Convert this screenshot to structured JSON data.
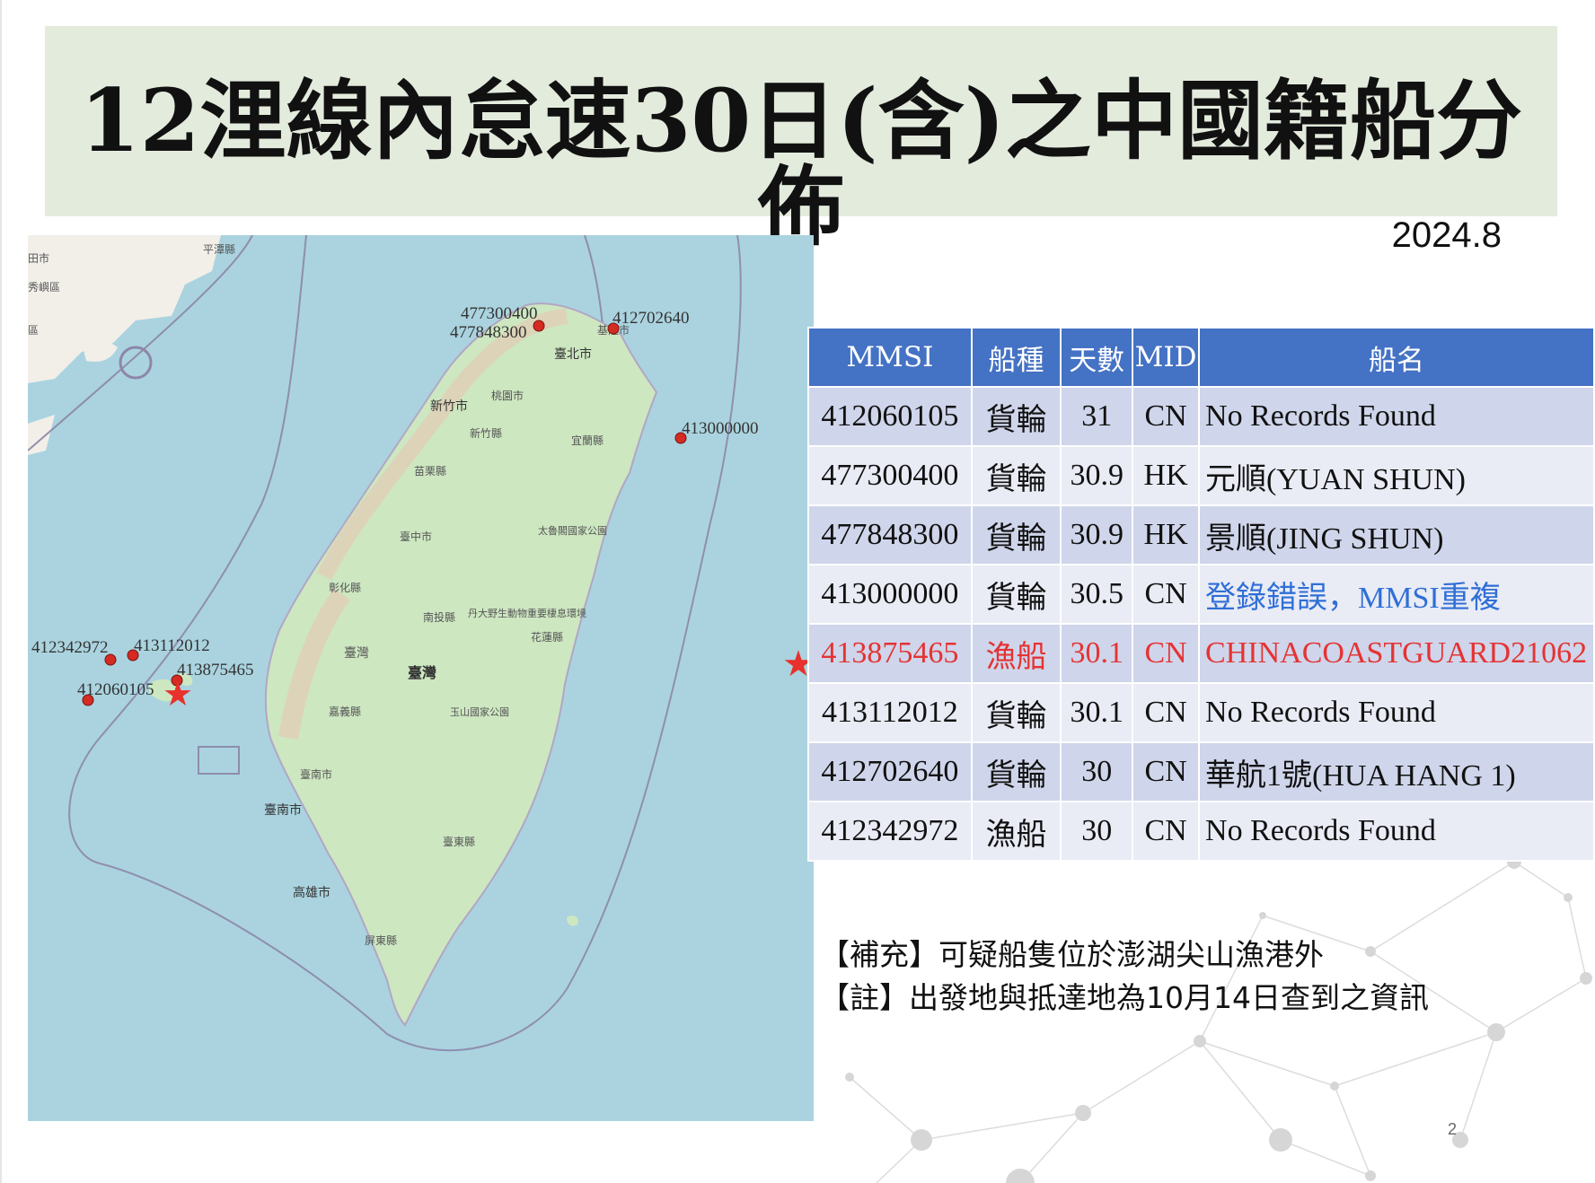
{
  "slide": {
    "title": "12浬線內怠速30日(含)之中國籍船分佈",
    "date": "2024.8",
    "page_number": "2"
  },
  "map": {
    "place_labels": [
      "平潭縣",
      "田市",
      "秀嶼區",
      "區",
      "基隆市",
      "臺北市",
      "桃園市",
      "新竹市",
      "新竹縣",
      "宜蘭縣",
      "苗栗縣",
      "臺中市",
      "太魯閣國家公園",
      "彰化縣",
      "南投縣",
      "丹大野生動物重要棲息環境",
      "花蓮縣",
      "臺灣",
      "臺灣",
      "嘉義縣",
      "玉山國家公園",
      "臺南市",
      "臺南市",
      "高雄市",
      "臺東縣",
      "屏東縣"
    ],
    "vessel_labels": [
      "477300400",
      "477848300",
      "412702640",
      "413000000",
      "412342972",
      "413112012",
      "413875465",
      "412060105"
    ],
    "highlight_color": "#e8312c",
    "marker_color": "#d42b22"
  },
  "table": {
    "headers": [
      "MMSI",
      "船種",
      "天數",
      "MID",
      "船名"
    ],
    "rows": [
      [
        "412060105",
        "貨輪",
        "31",
        "CN",
        "No Records Found"
      ],
      [
        "477300400",
        "貨輪",
        "30.9",
        "HK",
        "元順(YUAN SHUN)"
      ],
      [
        "477848300",
        "貨輪",
        "30.9",
        "HK",
        "景順(JING SHUN)"
      ],
      [
        "413000000",
        "貨輪",
        "30.5",
        "CN",
        "登錄錯誤，MMSI重複"
      ],
      [
        "413875465",
        "漁船",
        "30.1",
        "CN",
        "CHINACOASTGUARD21062"
      ],
      [
        "413112012",
        "貨輪",
        "30.1",
        "CN",
        "No Records Found"
      ],
      [
        "412702640",
        "貨輪",
        "30",
        "CN",
        "華航1號(HUA HANG 1)"
      ],
      [
        "412342972",
        "漁船",
        "30",
        "CN",
        "No Records Found"
      ]
    ],
    "header_color": "#4472c4",
    "highlight_row_color": "#e53333",
    "note_text_color": "#2f6fd6",
    "star_icon": "red-star"
  },
  "notes": [
    "【補充】可疑船隻位於澎湖尖山漁港外",
    "【註】出發地與抵達地為10月14日查到之資訊"
  ]
}
